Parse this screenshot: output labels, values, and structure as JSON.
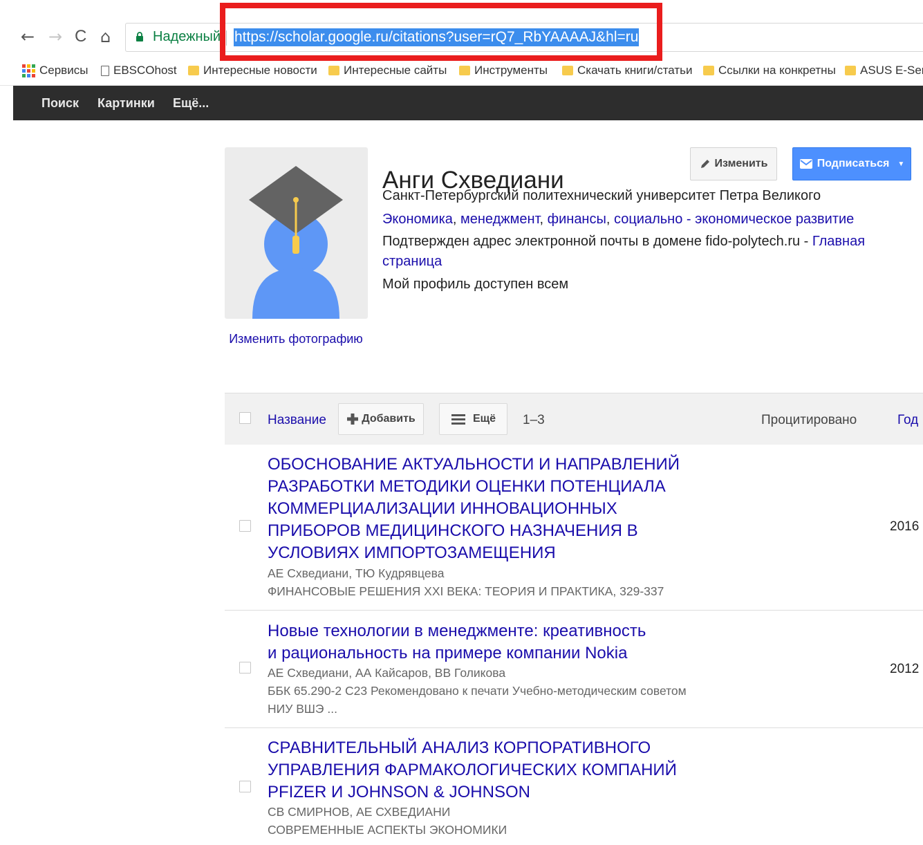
{
  "browser": {
    "nav": {
      "back": "←",
      "forward": "→",
      "reload": "C",
      "home": "⌂"
    },
    "secure_label": "Надежный",
    "url": "https://scholar.google.ru/citations?user=rQ7_RbYAAAAJ&hl=ru",
    "highlight_color": "#ea1d1d",
    "bookmarks": [
      {
        "label": "Сервисы",
        "icon": "apps-icon"
      },
      {
        "label": "EBSCOhost",
        "icon": "page-icon"
      },
      {
        "label": "Интересные новости",
        "icon": "folder-icon"
      },
      {
        "label": "Интересные сайты",
        "icon": "folder-icon"
      },
      {
        "label": "Инструменты",
        "icon": "folder-icon"
      },
      {
        "label": "Скачать книги/статьи",
        "icon": "folder-icon"
      },
      {
        "label": "Ссылки на конкретны",
        "icon": "folder-icon"
      },
      {
        "label": "ASUS E-Serv",
        "icon": "folder-icon"
      }
    ]
  },
  "topbar": {
    "search": "Поиск",
    "images": "Картинки",
    "more": "Ещё..."
  },
  "profile": {
    "name": "Анги Схведиани",
    "affiliation": "Санкт-Петербургский политехнический университет Петра Великого",
    "interests": [
      "Экономика",
      "менеджмент",
      "финансы",
      "социально - экономическое развитие"
    ],
    "email_note": "Подтвержден адрес электронной почты в домене fido-polytech.ru",
    "homepage_label_1": "Главная",
    "homepage_label_2": "страница",
    "visibility": "Мой профиль доступен всем",
    "change_photo": "Изменить фотографию",
    "edit_button": "Изменить",
    "follow_button": "Подписаться",
    "follow_color": "#4d90fe"
  },
  "table": {
    "col_title": "Название",
    "add_button": "Добавить",
    "more_button": "Ещё",
    "range": "1–3",
    "col_cited": "Процитировано",
    "col_year": "Год",
    "rows": [
      {
        "title": "ОБОСНОВАНИЕ АКТУАЛЬНОСТИ И НАПРАВЛЕНИЙ РАЗРАБОТКИ МЕТОДИКИ ОЦЕНКИ ПОТЕНЦИАЛА КОММЕРЦИАЛИЗАЦИИ ИННОВАЦИОННЫХ ПРИБОРОВ МЕДИЦИНСКОГО НАЗНАЧЕНИЯ В УСЛОВИЯХ ИМПОРТОЗАМЕЩЕНИЯ",
        "authors": "АЕ Схведиани, ТЮ Кудрявцева",
        "venue": "ФИНАНСОВЫЕ РЕШЕНИЯ XXI ВЕКА: ТЕОРИЯ И ПРАКТИКА, 329-337",
        "year": "2016"
      },
      {
        "title": "Новые технологии в менеджменте: креативность и рациональность на примере компании Nokia",
        "authors": "АЕ Схведиани, АА Кайсаров, ВВ Голикова",
        "venue": "ББК 65.290-2 С23 Рекомендовано к печати Учебно-методическим советом НИУ ВШЭ ...",
        "year": "2012"
      },
      {
        "title": "СРАВНИТЕЛЬНЫЙ АНАЛИЗ КОРПОРАТИВНОГО УПРАВЛЕНИЯ ФАРМАКОЛОГИЧЕСКИХ КОМПАНИЙ PFIZER И JOHNSON & JOHNSON",
        "authors": "СВ СМИРНОВ, АЕ СХВЕДИАНИ",
        "venue": "СОВРЕМЕННЫЕ АСПЕКТЫ ЭКОНОМИКИ",
        "year": ""
      }
    ]
  }
}
